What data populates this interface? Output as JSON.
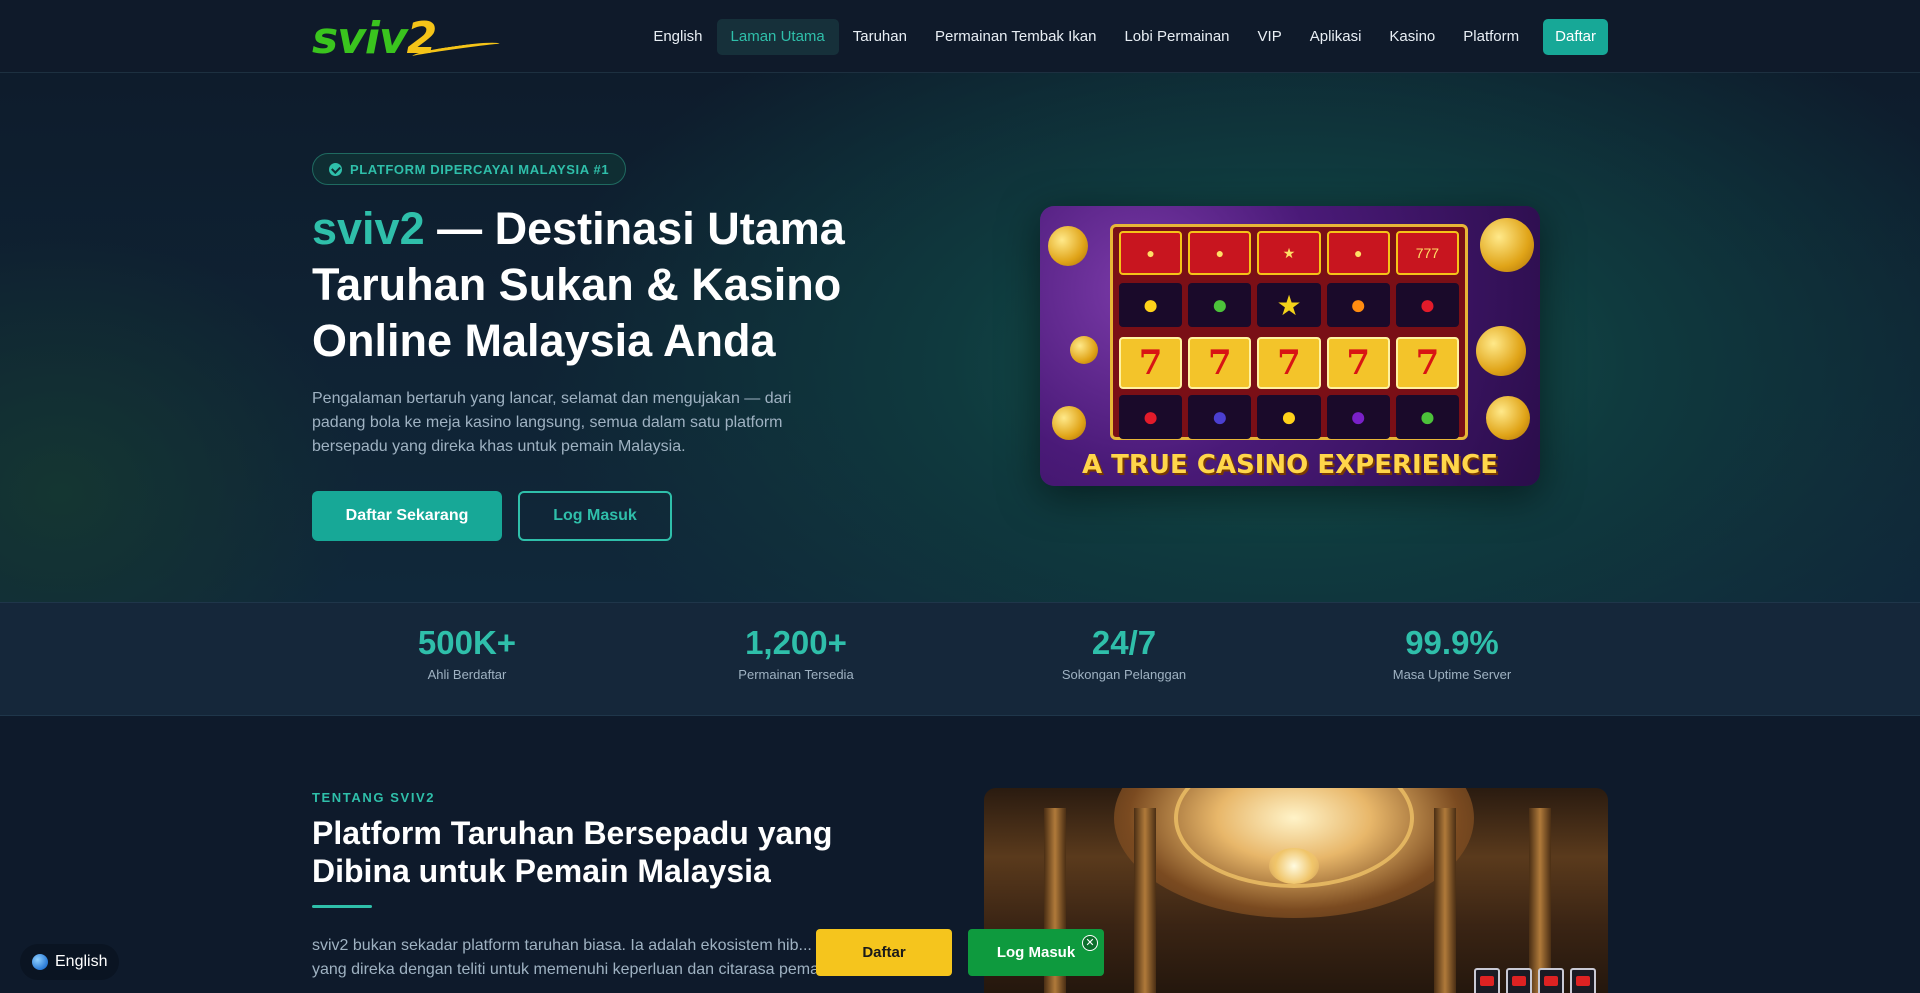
{
  "nav": {
    "logo_main": "sviv",
    "logo_num": "2",
    "items": [
      {
        "label": "English",
        "active": false
      },
      {
        "label": "Laman Utama",
        "active": true
      },
      {
        "label": "Taruhan",
        "active": false
      },
      {
        "label": "Permainan Tembak Ikan",
        "active": false
      },
      {
        "label": "Lobi Permainan",
        "active": false
      },
      {
        "label": "VIP",
        "active": false
      },
      {
        "label": "Aplikasi",
        "active": false
      },
      {
        "label": "Kasino",
        "active": false
      },
      {
        "label": "Platform",
        "active": false
      }
    ],
    "cta_label": "Daftar"
  },
  "hero": {
    "badge": "PLATFORM DIPERCAYAI MALAYSIA #1",
    "title_accent": "sviv2",
    "title_rest": " — Destinasi Utama Taruhan Sukan & Kasino Online Malaysia Anda",
    "description": "Pengalaman bertaruh yang lancar, selamat dan mengujakan — dari padang bola ke meja kasino langsung, semua dalam satu platform bersepadu yang direka khas untuk pemain Malaysia.",
    "primary_button": "Daftar Sekarang",
    "secondary_button": "Log Masuk",
    "image_caption": "A TRUE CASINO EXPERIENCE"
  },
  "stats": [
    {
      "value": "500K+",
      "label": "Ahli Berdaftar"
    },
    {
      "value": "1,200+",
      "label": "Permainan Tersedia"
    },
    {
      "value": "24/7",
      "label": "Sokongan Pelanggan"
    },
    {
      "value": "99.9%",
      "label": "Masa Uptime Server"
    }
  ],
  "about": {
    "eyebrow": "TENTANG SVIV2",
    "title": "Platform Taruhan Bersepadu yang Dibina untuk Pemain Malaysia",
    "text": "sviv2 bukan sekadar platform taruhan biasa. Ia adalah ekosistem hib... talian yang direka dengan teliti untuk memenuhi keperluan dan citarasa pemain"
  },
  "floating": {
    "language": "English",
    "daftar": "Daftar",
    "login": "Log Masuk",
    "close": "✕"
  },
  "colors": {
    "accent": "#2fbfaa",
    "primary_button": "#17a897",
    "background": "#0e1a2b",
    "float_yellow": "#f5c51d",
    "float_green": "#0e9a3e"
  }
}
